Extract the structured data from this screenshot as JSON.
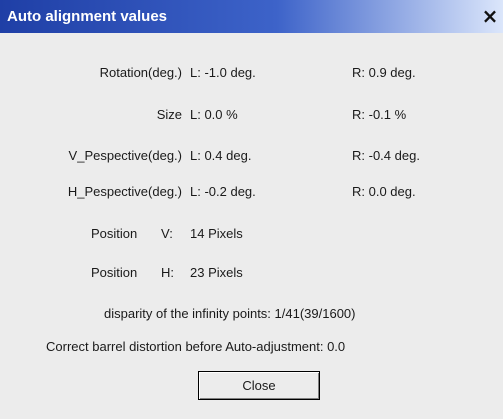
{
  "window": {
    "title": "Auto alignment values",
    "close_glyph": "×"
  },
  "rows": [
    {
      "label": "Rotation(deg.)",
      "left": "L: -1.0 deg.",
      "right": "R: 0.9 deg."
    },
    {
      "label": "Size",
      "left": "L: 0.0 %",
      "right": "R: -0.1 %"
    },
    {
      "label": "V_Pespective(deg.)",
      "left": "L: 0.4 deg.",
      "right": "R: -0.4 deg."
    },
    {
      "label": "H_Pespective(deg.)",
      "left": "L: -0.2 deg.",
      "right": "R: 0.0 deg."
    }
  ],
  "position": {
    "label": "Position",
    "v": {
      "axis": "V:",
      "value": "14 Pixels"
    },
    "h": {
      "axis": "H:",
      "value": "23 Pixels"
    }
  },
  "disparity": "disparity of the infinity points: 1/41(39/1600)",
  "barrel": "Correct barrel distortion before Auto-adjustment: 0.0",
  "buttons": {
    "close": "Close"
  }
}
